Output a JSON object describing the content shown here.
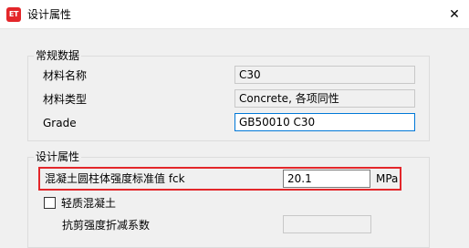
{
  "window": {
    "title": "设计属性",
    "icon_text": "ET",
    "close_glyph": "✕"
  },
  "general_group": {
    "title": "常规数据",
    "fields": [
      {
        "label": "材料名称",
        "value": "C30"
      },
      {
        "label": "材料类型",
        "value": "Concrete, 各项同性"
      },
      {
        "label": "Grade",
        "value": "GB50010 C30"
      }
    ]
  },
  "design_group": {
    "title": "设计属性",
    "fck": {
      "label": "混凝土圆柱体强度标准值 fck",
      "value": "20.1",
      "unit": "MPa"
    },
    "lightweight": {
      "label": "轻质混凝土",
      "checked": false
    },
    "shear_reduction": {
      "label": "抗剪强度折减系数",
      "value": ""
    }
  },
  "colors": {
    "highlight": "#e3262a",
    "focus": "#0078d7",
    "icon_bg": "#e3262a"
  }
}
